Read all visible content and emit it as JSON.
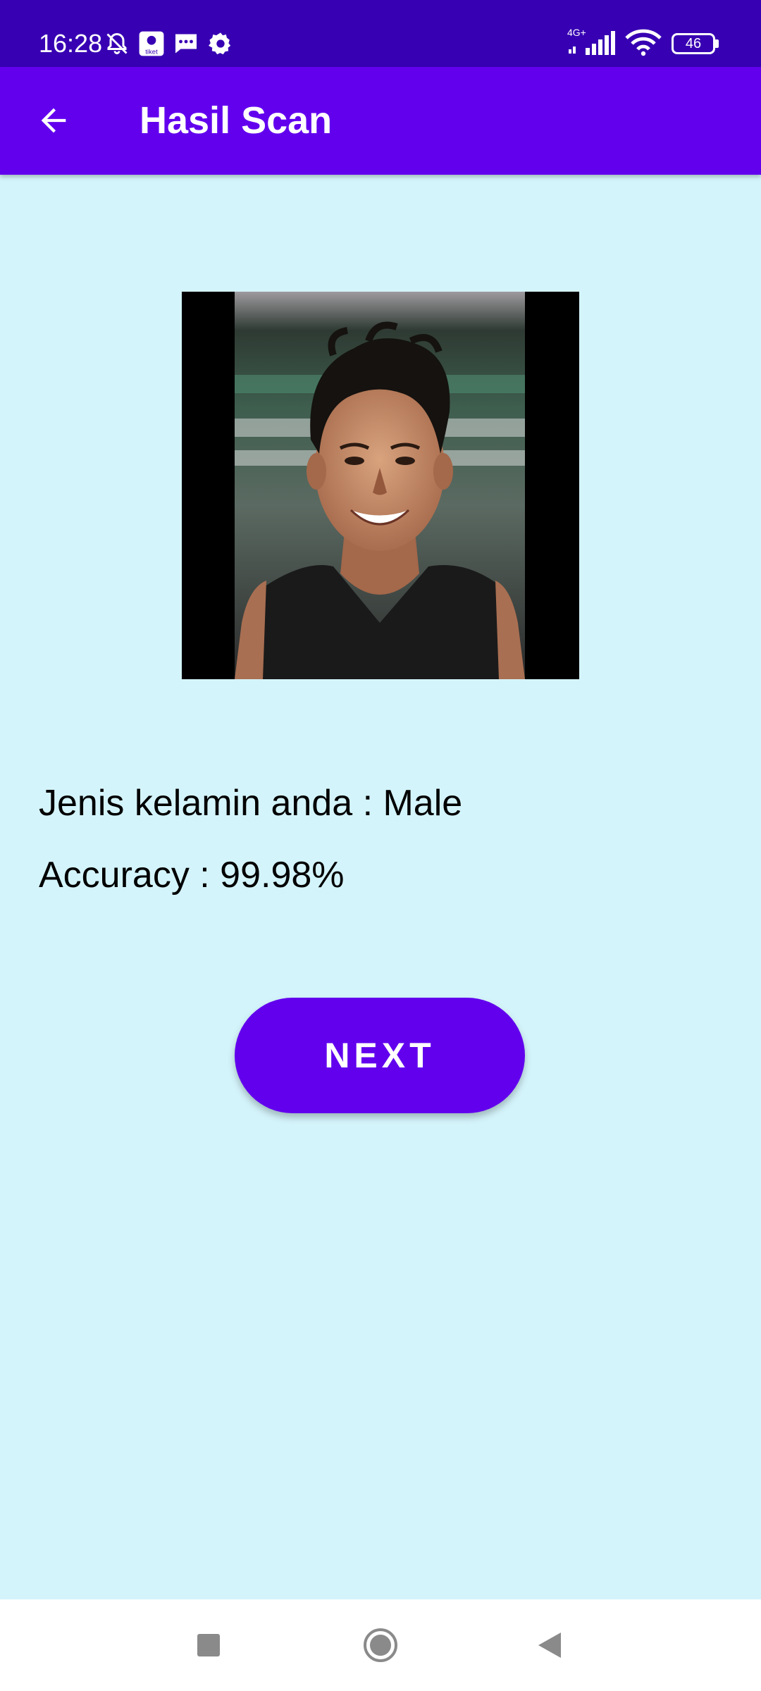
{
  "status_bar": {
    "time": "16:28",
    "network": "4G+",
    "battery": "46",
    "icons": [
      "bell-off-icon",
      "tiket-app-icon",
      "message-icon",
      "settings-gear-icon",
      "signal-icon",
      "wifi-icon",
      "battery-icon"
    ],
    "app_icon_label": "tiket"
  },
  "app_bar": {
    "title": "Hasil Scan",
    "back_icon": "arrow-left-icon"
  },
  "result": {
    "gender_line": "Jenis kelamin anda : Male",
    "accuracy_line": "Accuracy : 99.98%"
  },
  "actions": {
    "next_label": "NEXT"
  },
  "nav_bar": {
    "icons": [
      "recents-square-icon",
      "home-circle-icon",
      "back-triangle-icon"
    ]
  },
  "colors": {
    "status_bar": "#3700B3",
    "primary": "#6200EE",
    "background": "#D4F4FB",
    "on_primary": "#FFFFFF",
    "text": "#000000"
  }
}
